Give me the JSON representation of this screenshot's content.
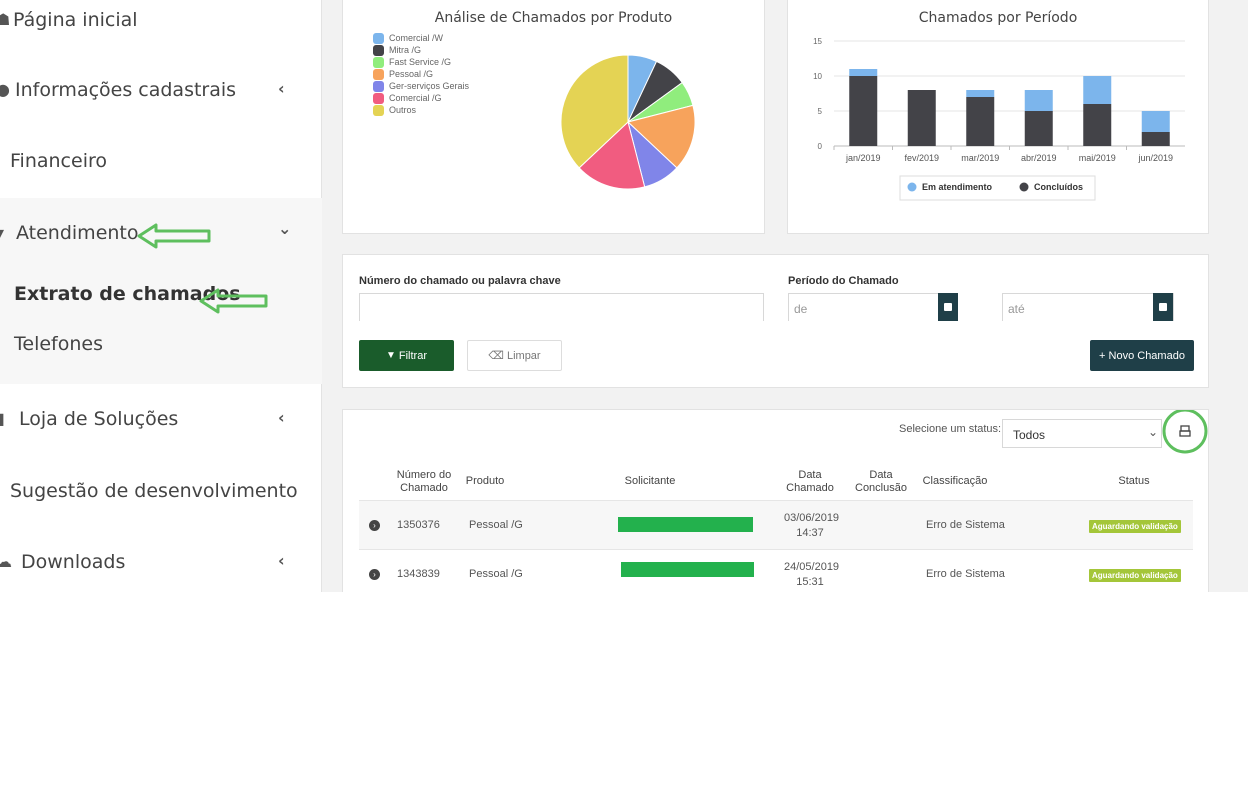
{
  "sidebar": {
    "items": [
      {
        "label": "Página inicial",
        "icon": "home-icon"
      },
      {
        "label": "Informações cadastrais",
        "icon": "info-icon",
        "chevron": "‹"
      },
      {
        "label": "Financeiro"
      },
      {
        "label": "Atendimento",
        "icon": "headset-icon",
        "chevron": "⌄"
      },
      {
        "label": "Extrato de chamados"
      },
      {
        "label": "Telefones"
      },
      {
        "label": "Loja de Soluções",
        "icon": "cart-icon",
        "chevron": "‹"
      },
      {
        "label": "Sugestão de desenvolvimento"
      },
      {
        "label": "Downloads",
        "icon": "cloud-icon",
        "chevron": "‹"
      }
    ],
    "arrow_color": "#5ebf5e"
  },
  "pie_chart": {
    "title": "Análise de Chamados por Produto"
  },
  "bar_chart": {
    "title": "Chamados por Período"
  },
  "chart_data": [
    {
      "type": "pie",
      "title": "Análise de Chamados por Produto",
      "labels": [
        "Comercial /W",
        "Mitra /G",
        "Fast Service /G",
        "Pessoal /G",
        "Ger-serviços Gerais",
        "Comercial /G",
        "Outros"
      ],
      "values": [
        7,
        8,
        6,
        16,
        9,
        17,
        37
      ],
      "colors": [
        "#7cb5ec",
        "#434348",
        "#90ed7d",
        "#f7a35c",
        "#8085e9",
        "#f15c80",
        "#e4d354"
      ],
      "legend": "top-left"
    },
    {
      "type": "bar",
      "stacked": true,
      "title": "Chamados por Período",
      "categories": [
        "jan/2019",
        "fev/2019",
        "mar/2019",
        "abr/2019",
        "mai/2019",
        "jun/2019"
      ],
      "series": [
        {
          "name": "Concluídos",
          "values": [
            10,
            8,
            7,
            5,
            6,
            2
          ],
          "color": "#434348"
        },
        {
          "name": "Em atendimento",
          "values": [
            1,
            0,
            1,
            3,
            4,
            3
          ],
          "color": "#7cb5ec"
        }
      ],
      "ylim": [
        0,
        15
      ],
      "yticks": [
        "0",
        "5",
        "10",
        "15"
      ],
      "grid": true,
      "legend": "bottom-center"
    }
  ],
  "filter": {
    "keyword_label": "Número do chamado ou palavra chave",
    "period_label": "Período do Chamado",
    "from_placeholder": "de",
    "to_placeholder": "até",
    "filter_button": "Filtrar",
    "clear_button": "Limpar",
    "new_button": "+ Novo Chamado"
  },
  "table": {
    "status_select_label": "Selecione um status:",
    "status_select_value": "Todos",
    "headers": [
      "Número do Chamado",
      "Produto",
      "Solicitante",
      "Data Chamado",
      "Data Conclusão",
      "Classificação",
      "Status"
    ],
    "rows": [
      {
        "number": "1350376",
        "product": "Pessoal /G",
        "date": "03/06/2019",
        "time": "14:37",
        "conclusion": "",
        "classification": "Erro de Sistema",
        "status": "Aguardando validação"
      },
      {
        "number": "1343839",
        "product": "Pessoal /G",
        "date": "24/05/2019",
        "time": "15:31",
        "conclusion": "",
        "classification": "Erro de Sistema",
        "status": "Aguardando validação"
      }
    ]
  },
  "colors": {
    "dark_button": "#1f3f48",
    "filter_button": "#1a5c2b",
    "status_badge": "#a4c639",
    "highlight_circle": "#5ebf5e"
  }
}
